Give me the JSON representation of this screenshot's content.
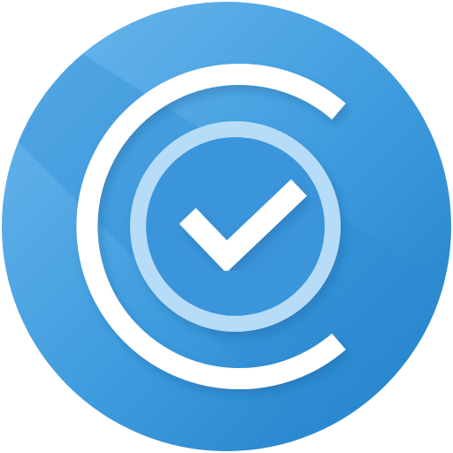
{
  "icon": {
    "name": "check-badge-app-icon",
    "glyph": "checkmark",
    "colors": {
      "background_light": "#6EB9EE",
      "background_mid": "#3D9BDD",
      "background_dark": "#1F7CC6",
      "stripe": "#2E8BD4",
      "c_stroke": "#FFFFFF",
      "inner_ring": "#B6DCF8",
      "inner_fill": "#3A95DA",
      "check": "#FFFFFF",
      "shadow": "#1B5E99"
    }
  }
}
